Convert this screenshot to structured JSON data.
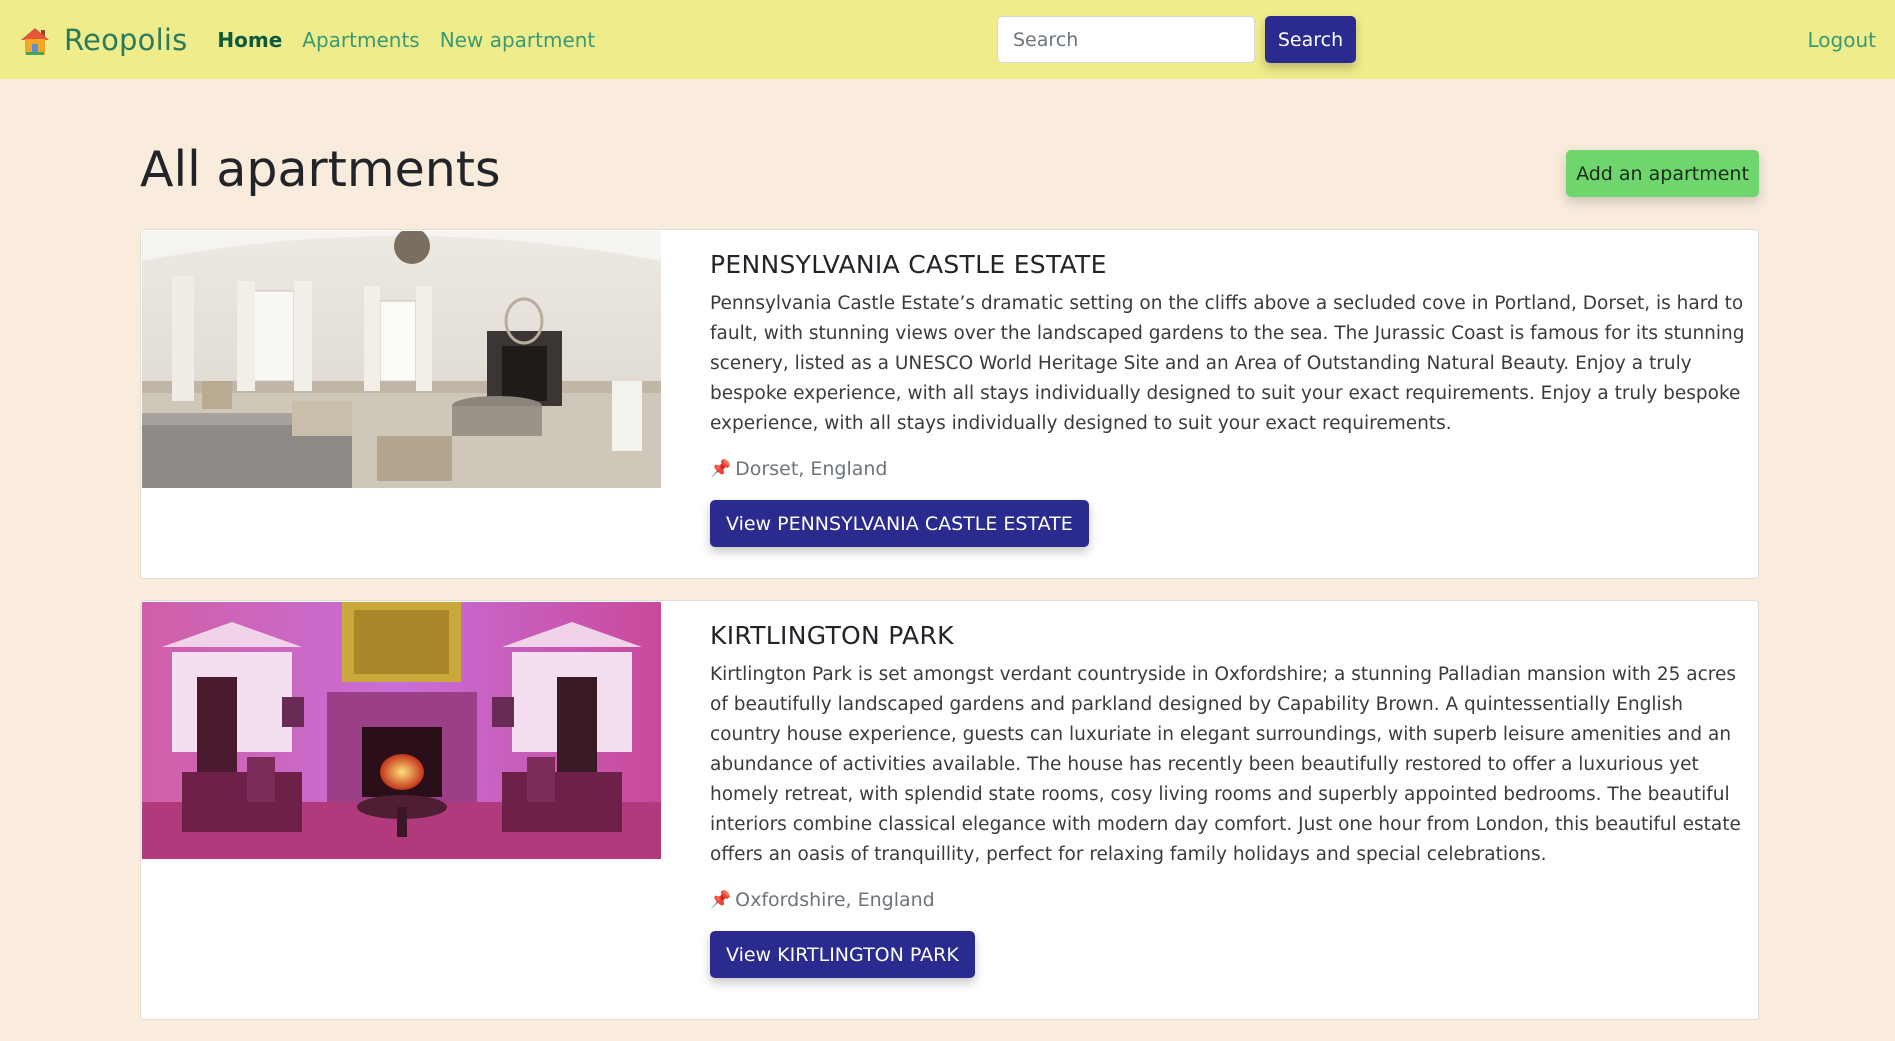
{
  "navbar": {
    "brand": "Reopolis",
    "links": [
      {
        "label": "Home"
      },
      {
        "label": "Apartments"
      },
      {
        "label": "New apartment"
      }
    ],
    "search_placeholder": "Search",
    "search_button": "Search",
    "logout": "Logout"
  },
  "page": {
    "title": "All apartments",
    "add_button": "Add an apartment"
  },
  "apartments": [
    {
      "title": "PENNSYLVANIA CASTLE ESTATE",
      "description": "Pennsylvania Castle Estate’s dramatic setting on the cliffs above a secluded cove in Portland, Dorset, is hard to fault, with stunning views over the landscaped gardens to the sea. The Jurassic Coast is famous for its stunning scenery, listed as a UNESCO World Heritage Site and an Area of Outstanding Natural Beauty. Enjoy a truly bespoke experience, with all stays individually designed to suit your exact requirements. Enjoy a truly bespoke experience, with all stays individually designed to suit your exact requirements.",
      "location": "Dorset, England",
      "button": "View PENNSYLVANIA CASTLE ESTATE"
    },
    {
      "title": "KIRTLINGTON PARK",
      "description": "Kirtlington Park is set amongst verdant countryside in Oxfordshire; a stunning Palladian mansion with 25 acres of beautifully landscaped gardens and parkland designed by Capability Brown. A quintessentially English country house experience, guests can luxuriate in elegant surroundings, with superb leisure amenities and an abundance of activities available. The house has recently been beautifully restored to offer a luxurious yet homely retreat, with splendid state rooms, cosy living rooms and superbly appointed bedrooms. The beautiful interiors combine classical elegance with modern day comfort. Just one hour from London, this beautiful estate offers an oasis of tranquillity, perfect for relaxing family holidays and special celebrations.",
      "location": "Oxfordshire, England",
      "button": "View KIRTLINGTON PARK"
    }
  ],
  "icons": {
    "brand": "house-icon",
    "location": "pushpin-icon"
  },
  "colors": {
    "navbar_bg": "#efec8c",
    "page_bg": "#f9ecdd",
    "primary": "#2b2a8f",
    "success": "#6fd66e",
    "link": "#3a9a75"
  }
}
